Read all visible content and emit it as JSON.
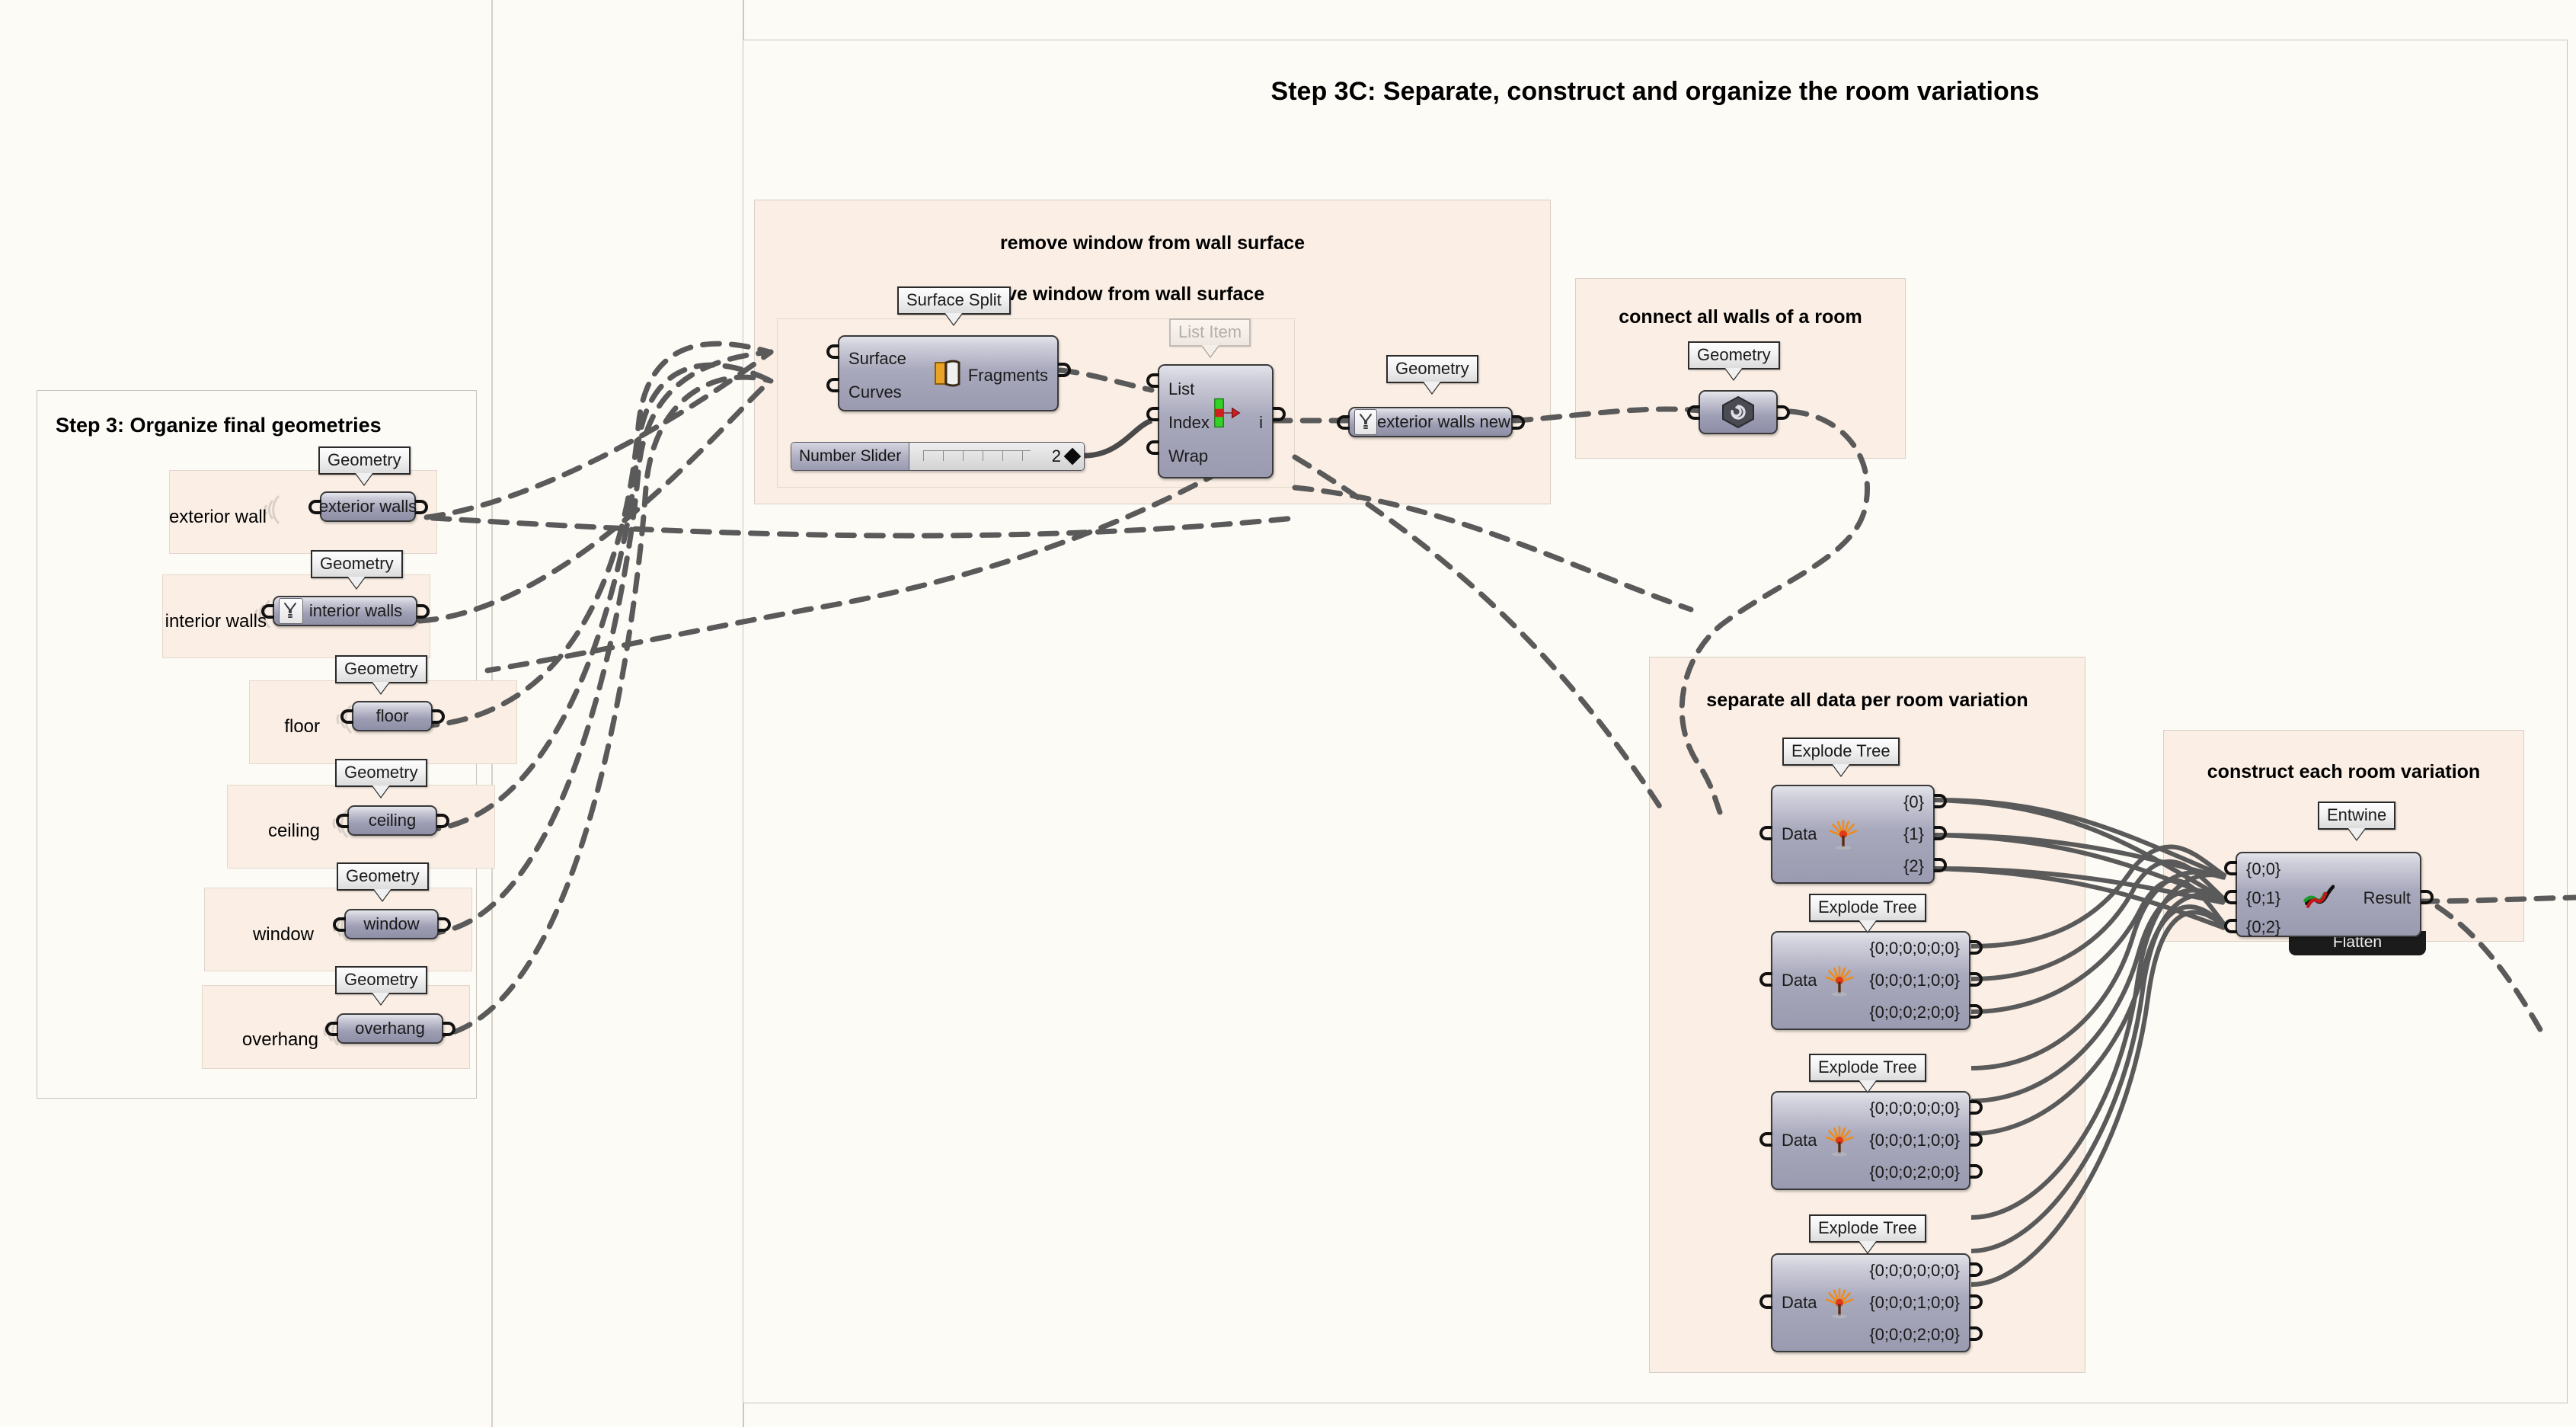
{
  "canvas": {
    "background_color": "#fdfbf6",
    "group_fill_color": "#fbefe5",
    "group_border_color": "#d8cfc6",
    "node_color": "#a8a8bb",
    "wire_color": "#5a5a5a"
  },
  "groups": {
    "step3": {
      "title": "Step 3: Organize final geometries"
    },
    "step3c": {
      "title": "Step 3C: Separate, construct and organize the room variations"
    },
    "remove_window_outer": {
      "title": "remove window from wall surface"
    },
    "remove_window_inner": {
      "title": "remove window from wall surface"
    },
    "connect_walls": {
      "title": "connect all walls of a room"
    },
    "separate_data": {
      "title": "separate all data per room variation"
    },
    "construct_room": {
      "title": "construct each room variation"
    }
  },
  "step3_params": [
    {
      "side_label": "exterior wall",
      "node_label": "exterior walls",
      "balloon": "Geometry",
      "icon": "none"
    },
    {
      "side_label": "interior walls",
      "node_label": "interior walls",
      "balloon": "Geometry",
      "icon": "wireless-receiver-icon"
    },
    {
      "side_label": "floor",
      "node_label": "floor",
      "balloon": "Geometry",
      "icon": "none"
    },
    {
      "side_label": "ceiling",
      "node_label": "ceiling",
      "balloon": "Geometry",
      "icon": "none"
    },
    {
      "side_label": "window",
      "node_label": "window",
      "balloon": "Geometry",
      "icon": "none"
    },
    {
      "side_label": "overhang",
      "node_label": "overhang",
      "balloon": "Geometry",
      "icon": "none"
    }
  ],
  "surface_split": {
    "balloon": "Surface Split",
    "inputs": [
      "Surface",
      "Curves"
    ],
    "outputs": [
      "Fragments"
    ],
    "icon": "surface-split-icon"
  },
  "number_slider": {
    "name": "Number Slider",
    "value": "2"
  },
  "list_item": {
    "balloon": "List Item",
    "balloon_state": "faded",
    "inputs": [
      "List",
      "Index",
      "Wrap"
    ],
    "outputs": [
      "i"
    ],
    "icon": "list-item-icon"
  },
  "exterior_walls_new": {
    "balloon": "Geometry",
    "label": "exterior walls new",
    "icon": "wireless-receiver-icon"
  },
  "connect_walls_node": {
    "balloon": "Geometry",
    "label": "",
    "icon": "spiral-icon"
  },
  "explode_trees": [
    {
      "balloon": "Explode Tree",
      "input": "Data",
      "outputs": [
        "{0}",
        "{1}",
        "{2}"
      ],
      "icon": "explode-tree-icon"
    },
    {
      "balloon": "Explode Tree",
      "input": "Data",
      "outputs": [
        "{0;0;0;0;0;0}",
        "{0;0;0;1;0;0}",
        "{0;0;0;2;0;0}"
      ],
      "icon": "explode-tree-icon"
    },
    {
      "balloon": "Explode Tree",
      "input": "Data",
      "outputs": [
        "{0;0;0;0;0;0}",
        "{0;0;0;1;0;0}",
        "{0;0;0;2;0;0}"
      ],
      "icon": "explode-tree-icon"
    },
    {
      "balloon": "Explode Tree",
      "input": "Data",
      "outputs": [
        "{0;0;0;0;0;0}",
        "{0;0;0;1;0;0}",
        "{0;0;0;2;0;0}"
      ],
      "icon": "explode-tree-icon"
    }
  ],
  "entwine": {
    "balloon": "Entwine",
    "inputs": [
      "{0;0}",
      "{0;1}",
      "{0;2}"
    ],
    "output": "Result",
    "tag": "Flatten",
    "icon": "entwine-icon"
  }
}
